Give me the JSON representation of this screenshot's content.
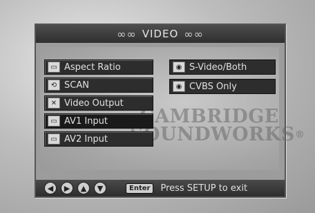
{
  "title": {
    "text": "VIDEO",
    "logo_left": "∞∞",
    "logo_right": "∞∞"
  },
  "watermark": {
    "line1": "CAMBRIDGE",
    "line2": "SOUNDWORKS",
    "reg": "®"
  },
  "menu": [
    {
      "label": "Aspect Ratio",
      "icon": "tv-icon"
    },
    {
      "label": "SCAN",
      "icon": "scan-icon"
    },
    {
      "label": "Video Output",
      "icon": "tools-icon"
    },
    {
      "label": "AV1 Input",
      "icon": "folder-icon"
    },
    {
      "label": "AV2 Input",
      "icon": "tv-icon"
    }
  ],
  "submenu": [
    {
      "label": "S-Video/Both",
      "icon": "disc-icon"
    },
    {
      "label": "CVBS Only",
      "icon": "disc-icon"
    }
  ],
  "footer": {
    "enter_label": "Enter",
    "hint": "Press SETUP to exit",
    "nav": [
      "left",
      "right",
      "up",
      "down"
    ]
  }
}
